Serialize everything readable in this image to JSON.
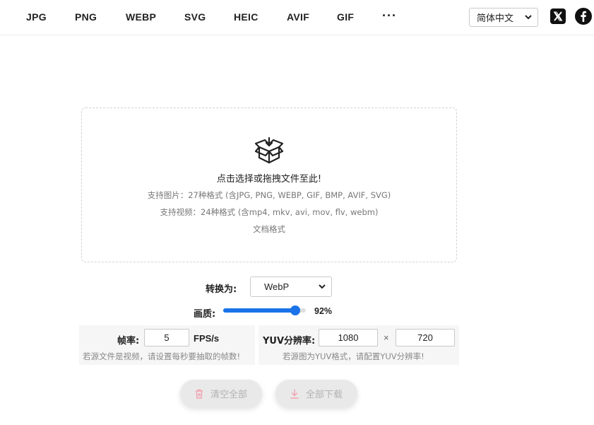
{
  "nav": {
    "items": [
      {
        "label": "JPG"
      },
      {
        "label": "PNG"
      },
      {
        "label": "WEBP"
      },
      {
        "label": "SVG"
      },
      {
        "label": "HEIC"
      },
      {
        "label": "AVIF"
      },
      {
        "label": "GIF"
      }
    ],
    "more_label": "···"
  },
  "language": {
    "selected": "简体中文"
  },
  "social": [
    {
      "icon": "x-logo-icon"
    },
    {
      "icon": "facebook-icon"
    }
  ],
  "dropzone": {
    "icon": "open-box-upload-icon",
    "title": "点击选择或拖拽文件至此!",
    "images_line": "支持图片：27种格式 (含JPG, PNG, WEBP, GIF, BMP, AVIF, SVG)",
    "videos_line": "支持视频：24种格式 (含mp4, mkv, avi, mov, flv, webm)",
    "docs_line": "文档格式"
  },
  "convert": {
    "label": "转换为:",
    "selected": "WebP"
  },
  "quality": {
    "label": "画质:",
    "value": 92,
    "display": "92%"
  },
  "framerate": {
    "label": "帧率:",
    "value": "5",
    "unit": "FPS/s",
    "hint": "若源文件是视频，请设置每秒要抽取的帧数!"
  },
  "yuv": {
    "label": "YUV分辨率:",
    "width": "1080",
    "separator": "×",
    "height": "720",
    "hint": "若源图为YUV格式，请配置YUV分辨率!"
  },
  "actions": {
    "clear_label": "清空全部",
    "download_label": "全部下载"
  },
  "colors": {
    "accent": "#1a73e8",
    "button_icon": "#f2a3b3",
    "disabled_text": "#b3b3b3"
  }
}
